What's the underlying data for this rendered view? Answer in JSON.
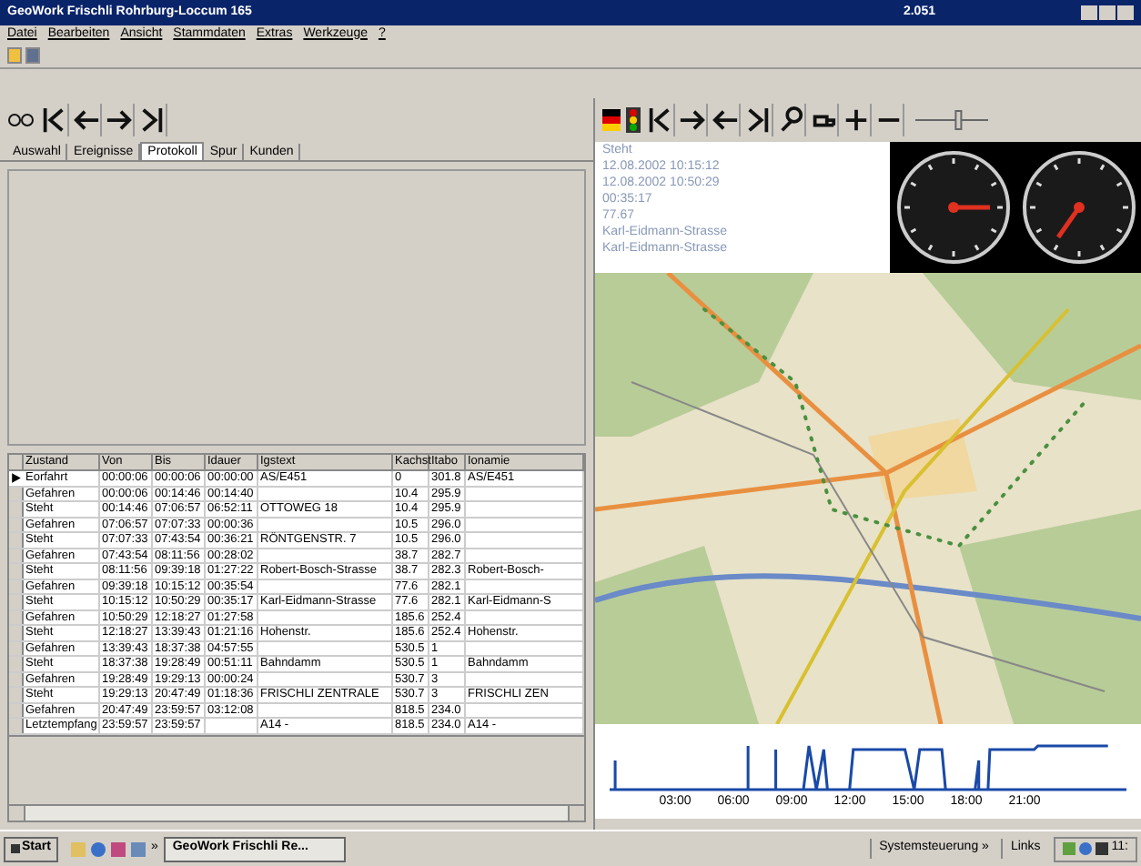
{
  "window": {
    "title": "GeoWork Frischli Rohrburg-Loccum 165",
    "version": "2.051"
  },
  "zoom_slider": {
    "level": 0.6
  },
  "menu": [
    "Datei",
    "Bearbeiten",
    "Ansicht",
    "Stammdaten",
    "Extras",
    "Werkzeuge",
    "?"
  ],
  "tabs": [
    {
      "label": "Auswahl",
      "selected": false
    },
    {
      "label": "Ereignisse",
      "selected": false
    },
    {
      "label": "Protokoll",
      "selected": true
    },
    {
      "label": "Spur",
      "selected": false
    },
    {
      "label": "Kunden",
      "selected": false
    }
  ],
  "table": {
    "columns": [
      "Zustand",
      "Von",
      "Bis",
      "Idauer",
      "Igstext",
      "Kachst",
      "Itabo",
      "Ionamie"
    ],
    "rows": [
      {
        "selected": true,
        "cells": [
          "Eorfahrt",
          "00:00:06",
          "00:00:06",
          "00:00:00",
          "AS/E451",
          "0",
          "301.8",
          "AS/E451"
        ]
      },
      {
        "selected": false,
        "cells": [
          "Gefahren",
          "00:00:06",
          "00:14:46",
          "00:14:40",
          "",
          "10.4",
          "295.9",
          ""
        ]
      },
      {
        "selected": false,
        "cells": [
          "Steht",
          "00:14:46",
          "07:06:57",
          "06:52:11",
          "OTTOWEG 18",
          "10.4",
          "295.9",
          ""
        ]
      },
      {
        "selected": false,
        "cells": [
          "Gefahren",
          "07:06:57",
          "07:07:33",
          "00:00:36",
          "",
          "10.5",
          "296.0",
          ""
        ]
      },
      {
        "selected": false,
        "cells": [
          "Steht",
          "07:07:33",
          "07:43:54",
          "00:36:21",
          "RÖNTGENSTR. 7",
          "10.5",
          "296.0",
          ""
        ]
      },
      {
        "selected": false,
        "cells": [
          "Gefahren",
          "07:43:54",
          "08:11:56",
          "00:28:02",
          "",
          "38.7",
          "282.7",
          ""
        ]
      },
      {
        "selected": false,
        "cells": [
          "Steht",
          "08:11:56",
          "09:39:18",
          "01:27:22",
          "Robert-Bosch-Strasse",
          "38.7",
          "282.3",
          "Robert-Bosch-"
        ]
      },
      {
        "selected": false,
        "cells": [
          "Gefahren",
          "09:39:18",
          "10:15:12",
          "00:35:54",
          "",
          "77.6",
          "282.1",
          ""
        ]
      },
      {
        "selected": false,
        "cells": [
          "Steht",
          "10:15:12",
          "10:50:29",
          "00:35:17",
          "Karl-Eidmann-Strasse",
          "77.6",
          "282.1",
          "Karl-Eidmann-S"
        ]
      },
      {
        "selected": false,
        "cells": [
          "Gefahren",
          "10:50:29",
          "12:18:27",
          "01:27:58",
          "",
          "185.6",
          "252.4",
          ""
        ]
      },
      {
        "selected": false,
        "cells": [
          "Steht",
          "12:18:27",
          "13:39:43",
          "01:21:16",
          "Hohenstr.",
          "185.6",
          "252.4",
          "Hohenstr."
        ]
      },
      {
        "selected": false,
        "cells": [
          "Gefahren",
          "13:39:43",
          "18:37:38",
          "04:57:55",
          "",
          "530.5",
          "1",
          ""
        ]
      },
      {
        "selected": false,
        "cells": [
          "Steht",
          "18:37:38",
          "19:28:49",
          "00:51:11",
          "Bahndamm",
          "530.5",
          "1",
          "Bahndamm"
        ]
      },
      {
        "selected": false,
        "cells": [
          "Gefahren",
          "19:28:49",
          "19:29:13",
          "00:00:24",
          "",
          "530.7",
          "3",
          ""
        ]
      },
      {
        "selected": false,
        "cells": [
          "Steht",
          "19:29:13",
          "20:47:49",
          "01:18:36",
          "FRISCHLI ZENTRALE",
          "530.7",
          "3",
          "FRISCHLI ZEN"
        ]
      },
      {
        "selected": false,
        "cells": [
          "Gefahren",
          "20:47:49",
          "23:59:57",
          "03:12:08",
          "",
          "818.5",
          "234.0",
          ""
        ]
      },
      {
        "selected": false,
        "cells": [
          "Letztempfang",
          "23:59:57",
          "23:59:57",
          "",
          "A14 -",
          "818.5",
          "234.0",
          "A14 -"
        ]
      }
    ]
  },
  "info": {
    "lines": [
      "Steht",
      "12.08.2002 10:15:12",
      "12.08.2002 10:50:29",
      "00:35:17",
      "77.67",
      "Karl-Eidmann-Strasse",
      "Karl-Eidmann-Strasse"
    ]
  },
  "activity_graph": {
    "time_labels": [
      "03:00",
      "06:00",
      "09:00",
      "12:00",
      "15:00",
      "18:00",
      "21:00"
    ]
  },
  "taskbar": {
    "start": "Start",
    "quick_more": "»",
    "task": "GeoWork Frischli Re...",
    "toolbar": "Systemsteuerung »",
    "links": "Links",
    "clock": "11:"
  }
}
